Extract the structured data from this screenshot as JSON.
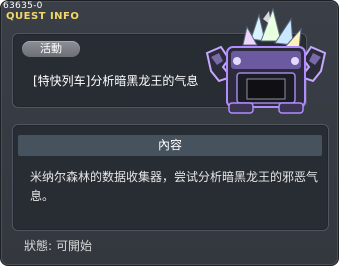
{
  "header": {
    "quest_id": "63635-0",
    "title": "QUEST INFO"
  },
  "quest": {
    "category_tag": "活動",
    "name": "[特快列车]分析暗黑龙王的气息",
    "icon": "dark-crystal-machine-icon"
  },
  "content": {
    "header": "內容",
    "description": "米纳尔森林的数据收集器，尝试分析暗黑龙王的邪恶气息。"
  },
  "status": {
    "label": "狀態:",
    "value": "可開始"
  },
  "colors": {
    "title_accent": "#f2d86a",
    "window_bg": "#3a3f47",
    "panel_bg": "#282c33"
  }
}
